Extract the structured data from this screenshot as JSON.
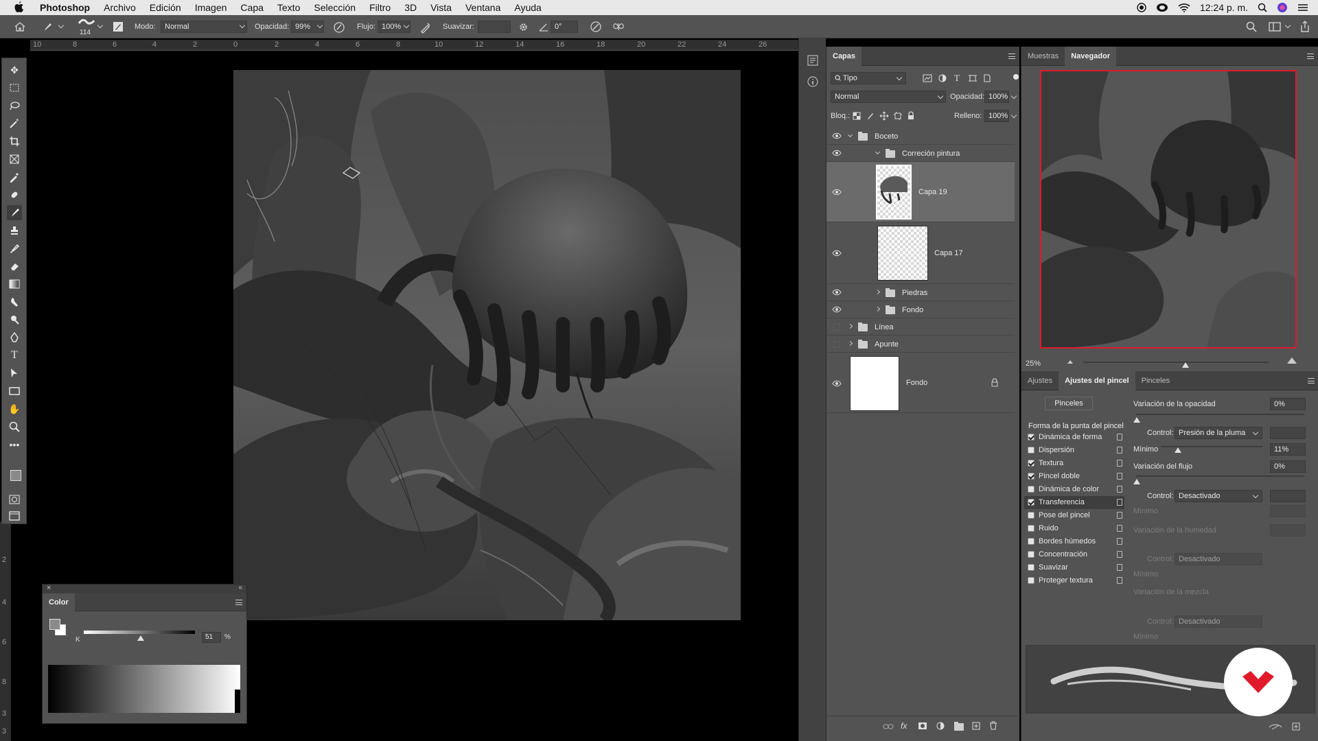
{
  "menubar": {
    "app": "Photoshop",
    "items": [
      "Archivo",
      "Edición",
      "Imagen",
      "Capa",
      "Texto",
      "Selección",
      "Filtro",
      "3D",
      "Vista",
      "Ventana",
      "Ayuda"
    ],
    "clock": "12:24 p. m."
  },
  "options": {
    "brush_size": "114",
    "mode_label": "Modo:",
    "mode_value": "Normal",
    "opacity_label": "Opacidad:",
    "opacity_value": "99%",
    "flow_label": "Flujo:",
    "flow_value": "100%",
    "smooth_label": "Suavizar:",
    "angle_value": "0°"
  },
  "ruler_h": [
    "10",
    "8",
    "6",
    "4",
    "2",
    "0",
    "2",
    "4",
    "6",
    "8",
    "10",
    "12",
    "14",
    "16",
    "18",
    "20",
    "22",
    "24",
    "26"
  ],
  "ruler_v": [
    "2",
    "4",
    "6",
    "8",
    "3",
    "3"
  ],
  "layers_panel": {
    "title": "Capas",
    "filter": "Tipo",
    "blend": "Normal",
    "opacity_label": "Opacidad:",
    "opacity_value": "100%",
    "lock_label": "Bloq.:",
    "fill_label": "Relleno:",
    "fill_value": "100%",
    "layers": [
      {
        "name": "Boceto"
      },
      {
        "name": "Correción pintura"
      },
      {
        "name": "Capa 19"
      },
      {
        "name": "Capa 17"
      },
      {
        "name": "Piedras"
      },
      {
        "name": "Fondo"
      },
      {
        "name": "Línea"
      },
      {
        "name": "Apunte"
      },
      {
        "name": "Fondo"
      }
    ]
  },
  "navigator": {
    "tabs": [
      "Muestras",
      "Navegador"
    ],
    "zoom": "25%",
    "zoom_level": 0.55
  },
  "brush_settings": {
    "tabs": [
      "Ajustes",
      "Ajustes del pincel",
      "Pinceles"
    ],
    "brushes_button": "Pinceles",
    "tip_shape": "Forma de la punta del pincel",
    "options": [
      {
        "label": "Dinámica de forma",
        "checked": true
      },
      {
        "label": "Dispersión",
        "checked": false
      },
      {
        "label": "Textura",
        "checked": true
      },
      {
        "label": "Pincel doble",
        "checked": true
      },
      {
        "label": "Dinámica de color",
        "checked": false
      },
      {
        "label": "Transferencia",
        "checked": true
      },
      {
        "label": "Pose del pincel",
        "checked": false
      },
      {
        "label": "Ruido",
        "checked": false
      },
      {
        "label": "Bordes húmedos",
        "checked": false
      },
      {
        "label": "Concentración",
        "checked": false
      },
      {
        "label": "Suavizar",
        "checked": false
      },
      {
        "label": "Proteger textura",
        "checked": false
      }
    ],
    "opacity_jitter_label": "Variación de la opacidad",
    "opacity_jitter_value": "0%",
    "control_label": "Control:",
    "control1_value": "Presión de la pluma",
    "minimum_label": "Mínimo",
    "minimum1_value": "11%",
    "flow_jitter_label": "Variación del flujo",
    "flow_jitter_value": "0%",
    "control2_value": "Desactivado",
    "wetness_label": "Variación de la humedad",
    "control3_value": "Desactivado",
    "mix_label": "Variación de la mezcla",
    "control4_value": "Desactivado"
  },
  "color_panel": {
    "title": "Color",
    "channel": "K",
    "value": "51",
    "unit": "%"
  },
  "colors": {
    "accent_red": "#e0192b",
    "panel_bg": "#535353"
  }
}
